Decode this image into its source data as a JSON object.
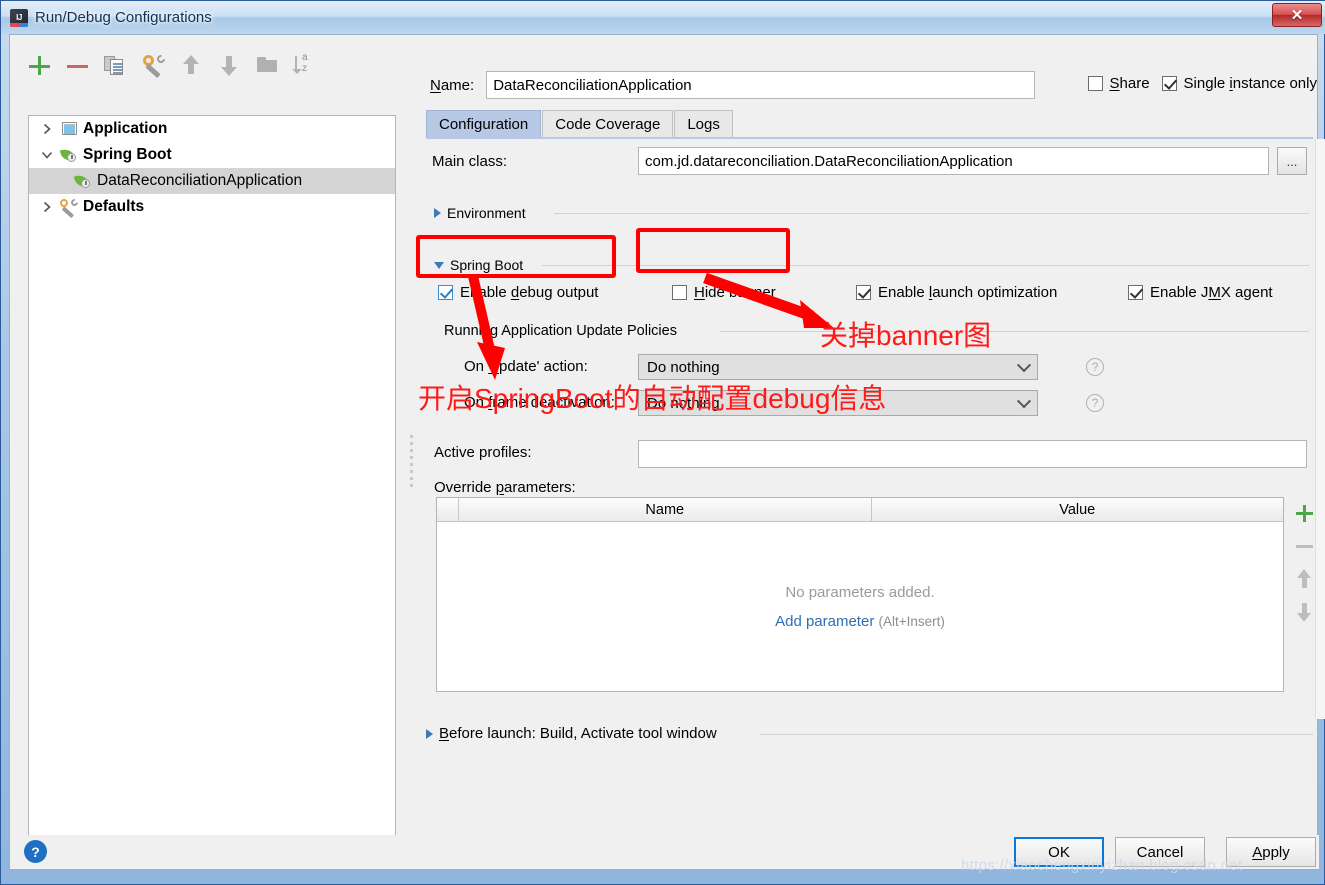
{
  "window": {
    "title": "Run/Debug Configurations",
    "app_icon": "intellij-idea-icon",
    "close_label": "✕"
  },
  "toolbar": {
    "icons": [
      {
        "name": "add-icon",
        "label": "+"
      },
      {
        "name": "remove-icon",
        "label": "−"
      },
      {
        "name": "copy-configuration-icon",
        "label": "Copy Configuration"
      },
      {
        "name": "edit-defaults-icon",
        "label": "Edit defaults"
      },
      {
        "name": "move-up-icon",
        "label": "Move Up"
      },
      {
        "name": "move-down-icon",
        "label": "Move Down"
      },
      {
        "name": "folder-icon",
        "label": "Create new folder"
      },
      {
        "name": "sort-alphabetically-icon",
        "label": "Sort configurations"
      }
    ]
  },
  "tree": {
    "items": [
      {
        "label": "Application",
        "icon": "application-icon",
        "toggle": "chevron-right",
        "bold": true,
        "indent": 0,
        "selected": false
      },
      {
        "label": "Spring Boot",
        "icon": "spring-leaf-icon",
        "toggle": "chevron-down",
        "bold": true,
        "indent": 0,
        "selected": false
      },
      {
        "label": "DataReconciliationApplication",
        "icon": "spring-leaf-icon",
        "toggle": "none",
        "bold": false,
        "indent": 1,
        "selected": true
      },
      {
        "label": "Defaults",
        "icon": "wrench-icon",
        "toggle": "chevron-right",
        "bold": true,
        "indent": 0,
        "selected": false
      }
    ]
  },
  "form": {
    "name_label": "Name:",
    "name_value": "DataReconciliationApplication",
    "share": {
      "label": "Share",
      "checked": false
    },
    "single_instance": {
      "label": "Single instance only",
      "checked": true
    },
    "tabs": [
      {
        "label": "Configuration",
        "active": true
      },
      {
        "label": "Code Coverage",
        "active": false
      },
      {
        "label": "Logs",
        "active": false
      }
    ],
    "main_class_label": "Main class:",
    "main_class_value": "com.jd.datareconciliation.DataReconciliationApplication",
    "main_class_browse": "...",
    "environment_section": {
      "label": "Environment",
      "expanded": false
    },
    "spring_boot_section": {
      "label": "Spring Boot",
      "expanded": true
    },
    "spring_checkboxes": [
      {
        "label": "Enable debug output",
        "checked": true,
        "mnemonic": "d",
        "name": "enable-debug-output-checkbox"
      },
      {
        "label": "Hide banner",
        "checked": false,
        "mnemonic": "H",
        "name": "hide-banner-checkbox"
      },
      {
        "label": "Enable launch optimization",
        "checked": true,
        "mnemonic": "l",
        "name": "enable-launch-optimization-checkbox"
      },
      {
        "label": "Enable JMX agent",
        "checked": true,
        "mnemonic": "M",
        "name": "enable-jmx-agent-checkbox"
      }
    ],
    "update_policies": {
      "group_label": "Running Application Update Policies",
      "on_update_label": "On 'Update' action:",
      "on_update_value": "Do nothing",
      "on_frame_label": "On frame deactivation:",
      "on_frame_value": "Do nothing",
      "help_glyph": "?"
    },
    "active_profiles_label": "Active profiles:",
    "active_profiles_value": "",
    "override_parameters_label": "Override parameters:",
    "parameters_table": {
      "columns": [
        "Name",
        "Value"
      ],
      "rows": [],
      "empty_message": "No parameters added.",
      "add_link": "Add parameter",
      "add_hint": "(Alt+Insert)"
    },
    "table_side_buttons": [
      {
        "name": "add-parameter-button",
        "glyph": "+"
      },
      {
        "name": "remove-parameter-button",
        "glyph": "−"
      },
      {
        "name": "move-parameter-up-button",
        "glyph": "↑"
      },
      {
        "name": "move-parameter-down-button",
        "glyph": "↓"
      }
    ],
    "before_launch": {
      "label": "Before launch: Build, Activate tool window",
      "expanded": false
    }
  },
  "bottom": {
    "help_glyph": "?",
    "ok": "OK",
    "cancel": "Cancel",
    "apply": "Apply"
  },
  "annotations": {
    "note_banner": "关掉banner图",
    "note_debug": "开启SpringBoot的自动配置debug信息",
    "color": "#ff0000"
  },
  "watermark": "https://xiaochengxinyizhan.blog.csdn.net"
}
